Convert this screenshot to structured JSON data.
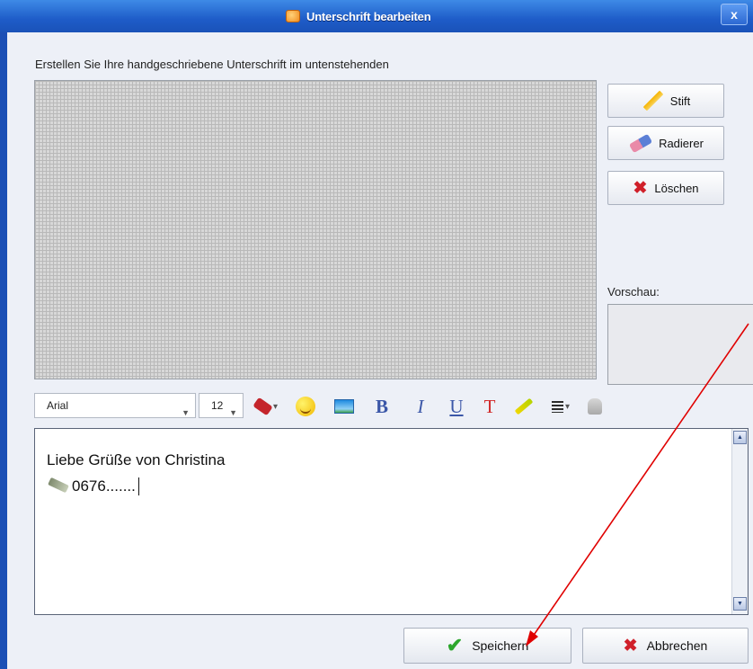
{
  "dialog": {
    "title": "Unterschrift bearbeiten",
    "close_label": "x",
    "instructions": "Erstellen Sie Ihre handgeschriebene Unterschrift im untenstehenden"
  },
  "tools": {
    "pen_label": "Stift",
    "eraser_label": "Radierer",
    "clear_label": "Löschen"
  },
  "preview": {
    "label": "Vorschau:"
  },
  "toolbar": {
    "font": "Arial",
    "size": "12"
  },
  "editor": {
    "line1": "Liebe Grüße von Christina",
    "line2": "0676......."
  },
  "buttons": {
    "save_label": "Speichern",
    "cancel_label": "Abbrechen"
  },
  "colors": {
    "titlebar": "#1e5cc8",
    "annotation_arrow": "#e00000"
  }
}
